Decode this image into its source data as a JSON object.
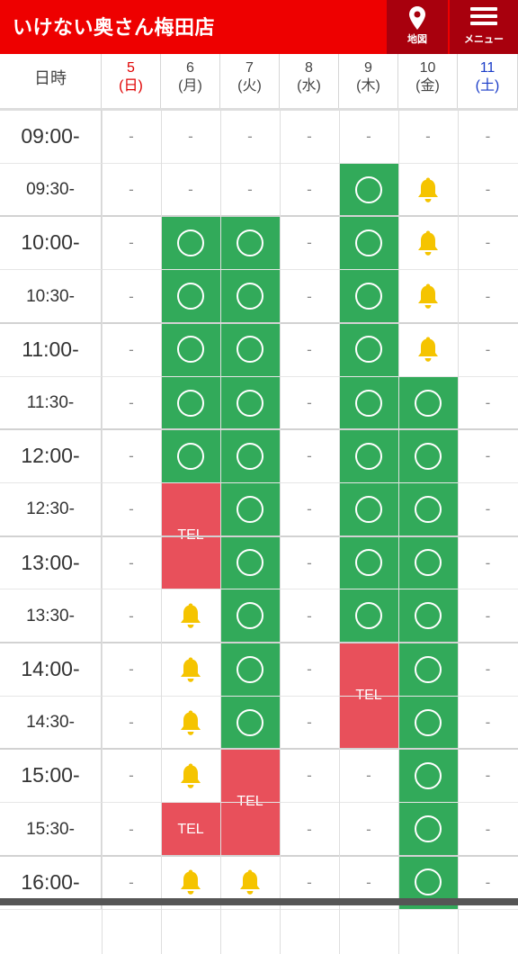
{
  "header": {
    "title": "いけない奥さん梅田店",
    "map_label": "地図",
    "menu_label": "メニュー"
  },
  "colors": {
    "header_bg": "#ee0000",
    "header_button_bg": "#a8000d",
    "available": "#32aa5a",
    "tel": "#e8505b",
    "bell": "#f5c400",
    "sunday": "#e00000",
    "saturday": "#1a3cc8"
  },
  "corner_label": "日時",
  "days": [
    {
      "num": "5",
      "wd": "(日)",
      "tone": "sunday"
    },
    {
      "num": "6",
      "wd": "(月)",
      "tone": "normal"
    },
    {
      "num": "7",
      "wd": "(火)",
      "tone": "normal"
    },
    {
      "num": "8",
      "wd": "(水)",
      "tone": "normal"
    },
    {
      "num": "9",
      "wd": "(木)",
      "tone": "normal"
    },
    {
      "num": "10",
      "wd": "(金)",
      "tone": "normal"
    },
    {
      "num": "11",
      "wd": "(土)",
      "tone": "saturday"
    }
  ],
  "times": [
    "09:00-",
    "09:30-",
    "10:00-",
    "10:30-",
    "11:00-",
    "11:30-",
    "12:00-",
    "12:30-",
    "13:00-",
    "13:30-",
    "14:00-",
    "14:30-",
    "15:00-",
    "15:30-",
    "16:00-"
  ],
  "legend_dash": "-",
  "slots": [
    [
      "-",
      "-",
      "-",
      "-",
      "-",
      "-",
      "-"
    ],
    [
      "-",
      "-",
      "-",
      "-",
      "O",
      "B",
      "-"
    ],
    [
      "-",
      "O",
      "O",
      "-",
      "O",
      "B",
      "-"
    ],
    [
      "-",
      "O",
      "O",
      "-",
      "O",
      "B",
      "-"
    ],
    [
      "-",
      "O",
      "O",
      "-",
      "O",
      "B",
      "-"
    ],
    [
      "-",
      "O",
      "O",
      "-",
      "O",
      "O",
      "-"
    ],
    [
      "-",
      "O",
      "O",
      "-",
      "O",
      "O",
      "-"
    ],
    [
      "-",
      "T",
      "O",
      "-",
      "O",
      "O",
      "-"
    ],
    [
      "-",
      "T",
      "O",
      "-",
      "O",
      "O",
      "-"
    ],
    [
      "-",
      "B",
      "O",
      "-",
      "O",
      "O",
      "-"
    ],
    [
      "-",
      "B",
      "O",
      "-",
      "T",
      "O",
      "-"
    ],
    [
      "-",
      "B",
      "O",
      "-",
      "T",
      "O",
      "-"
    ],
    [
      "-",
      "B",
      "T",
      "-",
      "-",
      "O",
      "-"
    ],
    [
      "-",
      "T",
      "T",
      "-",
      "-",
      "O",
      "-"
    ],
    [
      "-",
      "B",
      "B",
      "-",
      "-",
      "O",
      "-"
    ]
  ],
  "tel_blocks": [
    {
      "label": "TEL",
      "day": 1,
      "start": 7,
      "span": 2
    },
    {
      "label": "TEL",
      "day": 4,
      "start": 10,
      "span": 2
    },
    {
      "label": "TEL",
      "day": 2,
      "start": 12,
      "span": 2
    },
    {
      "label": "TEL",
      "day": 1,
      "start": 13,
      "span": 1
    }
  ],
  "icons": {
    "map": "map-pin-icon",
    "menu": "hamburger-menu-icon",
    "bell": "bell-icon",
    "available": "circle-icon"
  }
}
